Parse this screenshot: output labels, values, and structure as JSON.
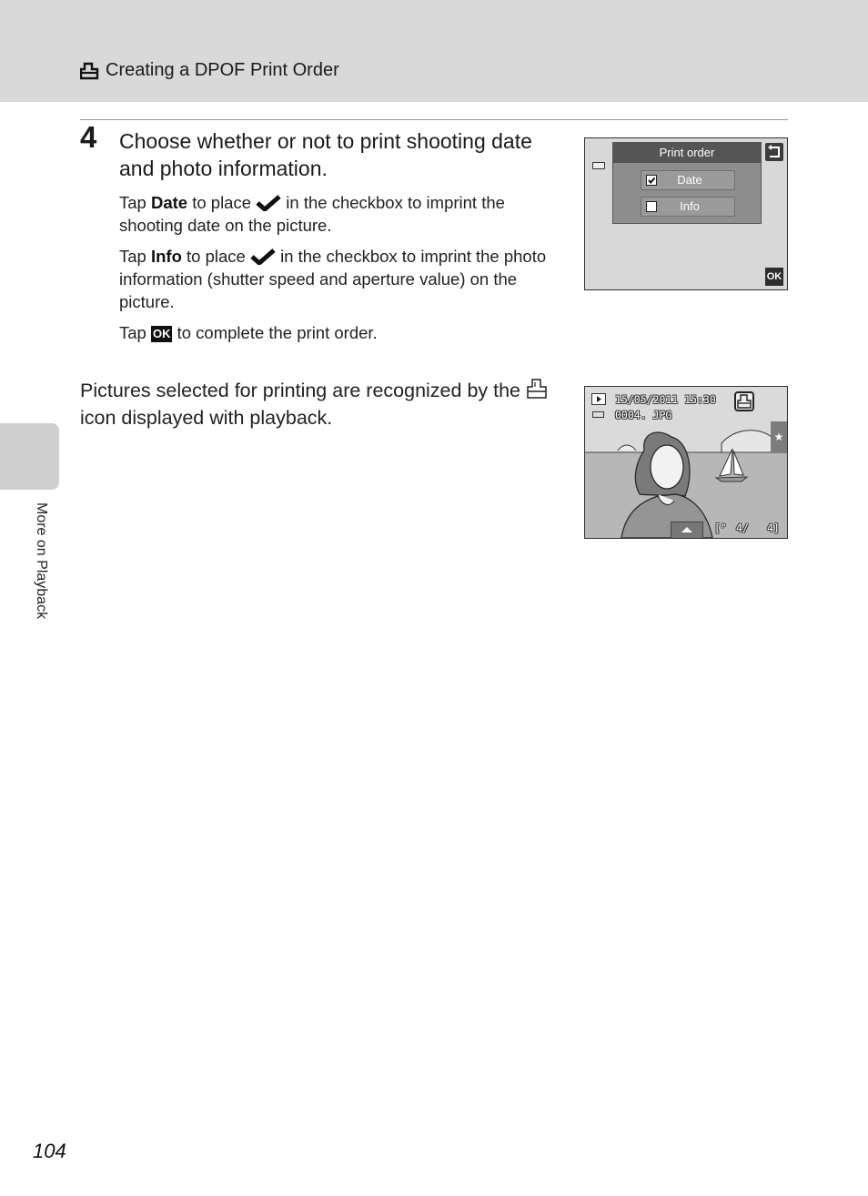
{
  "header": {
    "icon": "print-order-icon",
    "title": "Creating a DPOF Print Order"
  },
  "step": {
    "number": "4",
    "title": "Choose whether or not to print shooting date and photo information.",
    "paragraphs": [
      {
        "prefix": "Tap ",
        "bold": "Date",
        "mid": " to place ",
        "icon": "checkmark-icon",
        "suffix": " in the checkbox to imprint the shooting date on the picture."
      },
      {
        "prefix": "Tap ",
        "bold": "Info",
        "mid": " to place ",
        "icon": "checkmark-icon",
        "suffix": " in the checkbox to imprint the photo information (shutter speed and aperture value) on the picture."
      },
      {
        "prefix": "Tap ",
        "badge": "OK",
        "suffix": " to complete the print order."
      }
    ]
  },
  "note": {
    "line1": "Pictures selected for printing are recognized by the",
    "icon": "print-order-icon",
    "line2": "icon displayed with playback."
  },
  "screen_print_order": {
    "dialog_title": "Print order",
    "options": [
      {
        "label": "Date",
        "checked": true
      },
      {
        "label": "Info",
        "checked": false
      }
    ],
    "back_icon": "return-icon",
    "ok_label": "OK",
    "battery_icon": "battery-icon"
  },
  "screen_playback": {
    "play_icon": "playback-icon",
    "datetime": "15/05/2011  15:30",
    "filename": "0004. JPG",
    "counter_current": "4/",
    "counter_total": "4]",
    "counter_prefix": "[ᴾ",
    "star_label": "★",
    "print_indicator_icon": "print-order-icon"
  },
  "side_tab": {
    "label": "More on Playback"
  },
  "page_number": "104"
}
